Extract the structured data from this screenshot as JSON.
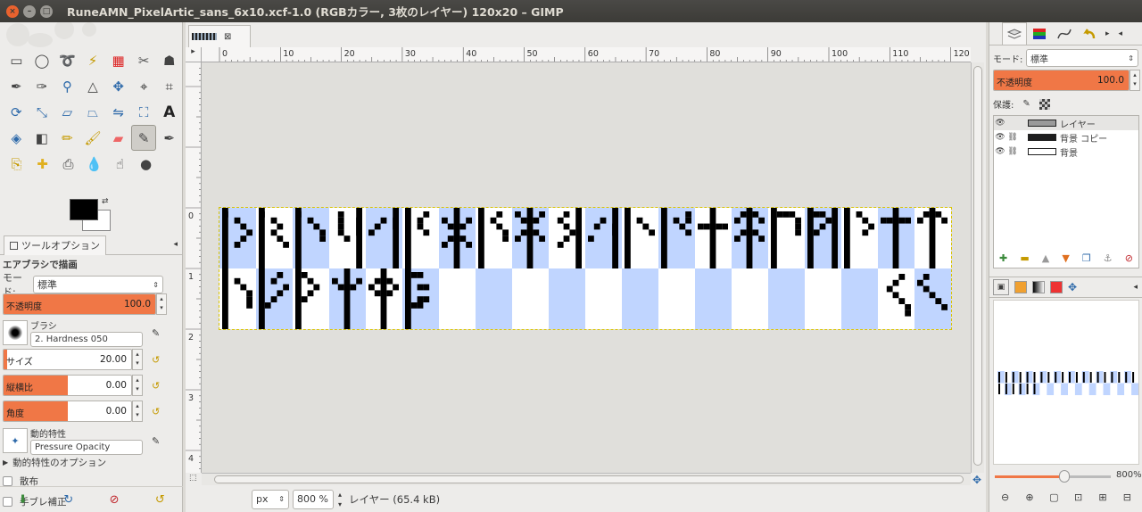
{
  "window": {
    "title": "RuneAMN_PixelArtic_sans_6x10.xcf-1.0 (RGBカラー, 3枚のレイヤー) 120x20 – GIMP"
  },
  "toolbox": {
    "tools": [
      [
        "rect-select-icon",
        "ellipse-select-icon",
        "lasso-icon",
        "fuzzy-select-icon",
        "select-by-color-icon",
        "scissors-icon",
        "foreground-select-icon"
      ],
      [
        "paths-icon",
        "color-picker-icon",
        "zoom-icon",
        "measure-icon",
        "move-icon",
        "align-icon",
        "crop-icon"
      ],
      [
        "rotate-icon",
        "scale-icon",
        "shear-icon",
        "perspective-icon",
        "flip-icon",
        "cage-icon",
        "text-tool-icon"
      ],
      [
        "bucket-fill-icon",
        "blend-icon",
        "pencil-icon",
        "paintbrush-icon",
        "eraser-icon",
        "airbrush-icon",
        "ink-icon"
      ],
      [
        "clone-icon",
        "heal-icon",
        "perspective-clone-icon",
        "blur-icon",
        "smudge-icon",
        "dodge-burn-icon"
      ]
    ],
    "fg_color": "#000000",
    "bg_color": "#ffffff"
  },
  "tool_options": {
    "tab_label": "ツールオプション",
    "heading": "エアブラシで描画",
    "mode_label": "モード:",
    "mode_value": "標準",
    "opacity_label": "不透明度",
    "opacity_value": "100.0",
    "brush_label": "ブラシ",
    "brush_value": "2. Hardness 050",
    "size_label": "サイズ",
    "size_value": "20.00",
    "aspect_label": "縦横比",
    "aspect_value": "0.00",
    "angle_label": "角度",
    "angle_value": "0.00",
    "dynamics_label": "動的特性",
    "dynamics_value": "Pressure Opacity",
    "dynamics_options": "動的特性のオプション",
    "scatter_label": "散布",
    "stabilize_label": "手ブレ補正"
  },
  "image": {
    "tab_name": "image-tab",
    "ruler_labels": [
      "0",
      "10",
      "20",
      "30",
      "40",
      "50",
      "60",
      "70",
      "80",
      "90",
      "100",
      "110",
      "120"
    ],
    "vruler_labels": [
      "0",
      "1",
      "2",
      "3",
      "4"
    ],
    "unit": "px",
    "zoom": "800 %",
    "status": "レイヤー (65.4 kB)"
  },
  "dock": {
    "mode_label": "モード:",
    "mode_value": "標準",
    "opacity_label": "不透明度",
    "opacity_value": "100.0",
    "lock_label": "保護:",
    "layers": [
      {
        "name": "レイヤー",
        "selected": true
      },
      {
        "name": "背景 コピー",
        "selected": false
      },
      {
        "name": "背景",
        "selected": false
      }
    ],
    "nav_zoom": "800%",
    "nav_zoom_fraction": 0.6
  },
  "colors": {
    "accent": "#f07746",
    "tile_blue": "#c0d5ff"
  }
}
